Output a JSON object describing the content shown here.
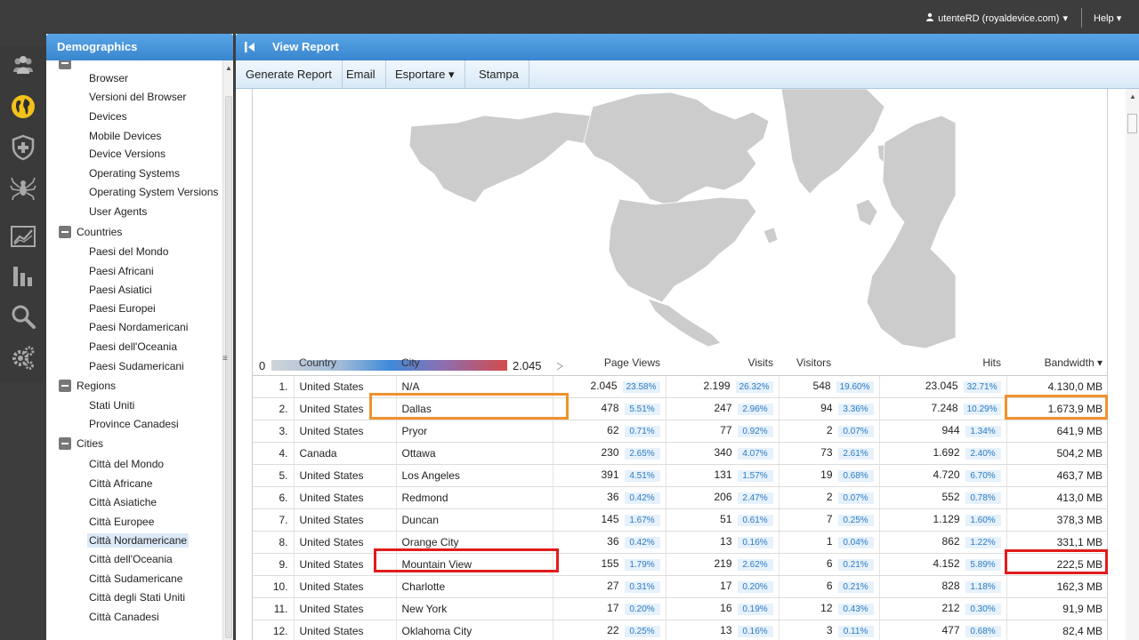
{
  "topbar": {
    "user": "utenteRD (royaldevice.com)",
    "help": "Help"
  },
  "rail": {
    "icons": [
      "users-icon",
      "globe-icon",
      "shield-plus-icon",
      "spider-icon",
      "chart-line-icon",
      "bar-chart-icon",
      "search-icon",
      "gears-icon"
    ]
  },
  "left_panel": {
    "title": "Demographics",
    "items_browser": [
      "Browser",
      "Versioni del Browser",
      "Devices",
      "Mobile Devices",
      "Device Versions",
      "Operating Systems",
      "Operating System Versions",
      "User Agents"
    ],
    "group_countries": "Countries",
    "items_countries": [
      "Paesi del Mondo",
      "Paesi Africani",
      "Paesi Asiatici",
      "Paesi Europei",
      "Paesi Nordamericani",
      "Paesi dell'Oceania",
      "Paesi Sudamericani"
    ],
    "group_regions": "Regions",
    "items_regions": [
      "Stati Uniti",
      "Province Canadesi"
    ],
    "group_cities": "Cities",
    "items_cities": [
      "Città del Mondo",
      "Città Africane",
      "Città Asiatiche",
      "Città Europee",
      "Città Nordamericane",
      "Città dell'Oceania",
      "Città Sudamericane",
      "Città degli Stati Uniti",
      "Città Canadesi"
    ],
    "selected": "Città Nordamericane"
  },
  "main": {
    "title": "View Report",
    "toolbar": {
      "generate": "Generate Report",
      "email": "Email",
      "export": "Esportare",
      "print": "Stampa"
    },
    "legend": {
      "min": "0",
      "max": "2.045"
    },
    "columns": [
      "",
      "Country",
      "City",
      "Page Views",
      "Visits",
      "Visitors",
      "Hits",
      "Bandwidth"
    ],
    "rows": [
      {
        "n": "1.",
        "country": "United States",
        "city": "N/A",
        "pv": "2.045",
        "pvp": "23.58%",
        "vi": "2.199",
        "vip": "26.32%",
        "vs": "548",
        "vsp": "19.60%",
        "hi": "23.045",
        "hip": "32.71%",
        "bw": "4.130,0 MB"
      },
      {
        "n": "2.",
        "country": "United States",
        "city": "Dallas",
        "pv": "478",
        "pvp": "5.51%",
        "vi": "247",
        "vip": "2.96%",
        "vs": "94",
        "vsp": "3.36%",
        "hi": "7.248",
        "hip": "10.29%",
        "bw": "1.673,9 MB"
      },
      {
        "n": "3.",
        "country": "United States",
        "city": "Pryor",
        "pv": "62",
        "pvp": "0.71%",
        "vi": "77",
        "vip": "0.92%",
        "vs": "2",
        "vsp": "0.07%",
        "hi": "944",
        "hip": "1.34%",
        "bw": "641,9 MB"
      },
      {
        "n": "4.",
        "country": "Canada",
        "city": "Ottawa",
        "pv": "230",
        "pvp": "2.65%",
        "vi": "340",
        "vip": "4.07%",
        "vs": "73",
        "vsp": "2.61%",
        "hi": "1.692",
        "hip": "2.40%",
        "bw": "504,2 MB"
      },
      {
        "n": "5.",
        "country": "United States",
        "city": "Los Angeles",
        "pv": "391",
        "pvp": "4.51%",
        "vi": "131",
        "vip": "1.57%",
        "vs": "19",
        "vsp": "0.68%",
        "hi": "4.720",
        "hip": "6.70%",
        "bw": "463,7 MB"
      },
      {
        "n": "6.",
        "country": "United States",
        "city": "Redmond",
        "pv": "36",
        "pvp": "0.42%",
        "vi": "206",
        "vip": "2.47%",
        "vs": "2",
        "vsp": "0.07%",
        "hi": "552",
        "hip": "0.78%",
        "bw": "413,0 MB"
      },
      {
        "n": "7.",
        "country": "United States",
        "city": "Duncan",
        "pv": "145",
        "pvp": "1.67%",
        "vi": "51",
        "vip": "0.61%",
        "vs": "7",
        "vsp": "0.25%",
        "hi": "1.129",
        "hip": "1.60%",
        "bw": "378,3 MB"
      },
      {
        "n": "8.",
        "country": "United States",
        "city": "Orange City",
        "pv": "36",
        "pvp": "0.42%",
        "vi": "13",
        "vip": "0.16%",
        "vs": "1",
        "vsp": "0.04%",
        "hi": "862",
        "hip": "1.22%",
        "bw": "331,1 MB"
      },
      {
        "n": "9.",
        "country": "United States",
        "city": "Mountain View",
        "pv": "155",
        "pvp": "1.79%",
        "vi": "219",
        "vip": "2.62%",
        "vs": "6",
        "vsp": "0.21%",
        "hi": "4.152",
        "hip": "5.89%",
        "bw": "222,5 MB"
      },
      {
        "n": "10.",
        "country": "United States",
        "city": "Charlotte",
        "pv": "27",
        "pvp": "0.31%",
        "vi": "17",
        "vip": "0.20%",
        "vs": "6",
        "vsp": "0.21%",
        "hi": "828",
        "hip": "1.18%",
        "bw": "162,3 MB"
      },
      {
        "n": "11.",
        "country": "United States",
        "city": "New York",
        "pv": "17",
        "pvp": "0.20%",
        "vi": "16",
        "vip": "0.19%",
        "vs": "12",
        "vsp": "0.43%",
        "hi": "212",
        "hip": "0.30%",
        "bw": "91,9 MB"
      },
      {
        "n": "12.",
        "country": "United States",
        "city": "Oklahoma City",
        "pv": "22",
        "pvp": "0.25%",
        "vi": "13",
        "vip": "0.16%",
        "vs": "3",
        "vsp": "0.11%",
        "hi": "477",
        "hip": "0.68%",
        "bw": "82,4 MB"
      }
    ]
  },
  "colors": {
    "accent": "#3a86cf",
    "highlight_orange": "#f0922e",
    "highlight_red": "#e21b1b"
  }
}
